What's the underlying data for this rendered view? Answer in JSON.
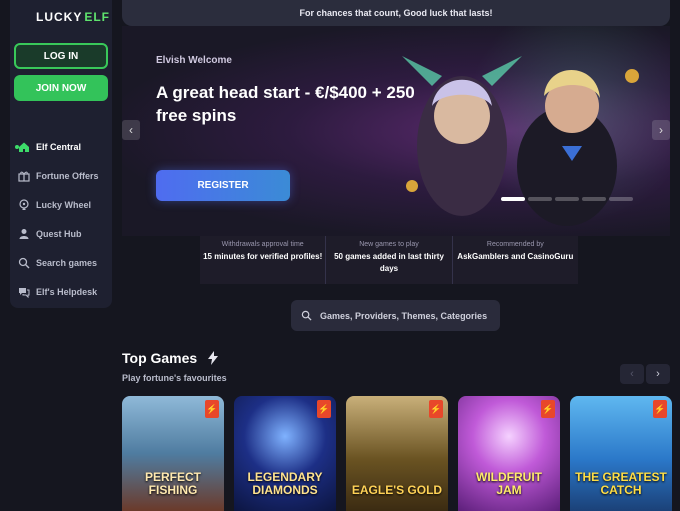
{
  "brand": {
    "part1": "LUCKY",
    "part2": "ELF"
  },
  "auth": {
    "login": "LOG IN",
    "join": "JOIN NOW"
  },
  "nav": [
    {
      "label": "Elf Central",
      "icon": "home-icon"
    },
    {
      "label": "Fortune Offers",
      "icon": "gift-icon"
    },
    {
      "label": "Lucky Wheel",
      "icon": "wheel-icon"
    },
    {
      "label": "Quest Hub",
      "icon": "quest-icon"
    },
    {
      "label": "Search games",
      "icon": "search-icon"
    },
    {
      "label": "Elf's Helpdesk",
      "icon": "helpdesk-icon"
    }
  ],
  "notice": "For chances that count, Good luck that lasts!",
  "hero": {
    "subtitle": "Elvish Welcome",
    "title": "A great head start - €/$400 + 250 free spins",
    "cta": "REGISTER",
    "slides": 5,
    "active_slide": 1
  },
  "stats": [
    {
      "label": "Withdrawals approval time",
      "value": "15 minutes for verified profiles!"
    },
    {
      "label": "New games to play",
      "value": "50 games added in last thirty days"
    },
    {
      "label": "Recommended by",
      "value": "AskGamblers and CasinoGuru"
    }
  ],
  "search": {
    "placeholder": "Games, Providers, Themes, Categories"
  },
  "top_games": {
    "title": "Top Games",
    "subtitle": "Play fortune's favourites",
    "games": [
      {
        "name": "PERFECT FISHING"
      },
      {
        "name": "LEGENDARY DIAMONDS"
      },
      {
        "name": "EAGLE'S GOLD"
      },
      {
        "name": "WILDFRUIT JAM"
      },
      {
        "name": "THE GREATEST CATCH"
      }
    ]
  },
  "colors": {
    "accent_green": "#33c35a",
    "register_blue": "#4f6cf0",
    "badge_red": "#e8472a"
  }
}
